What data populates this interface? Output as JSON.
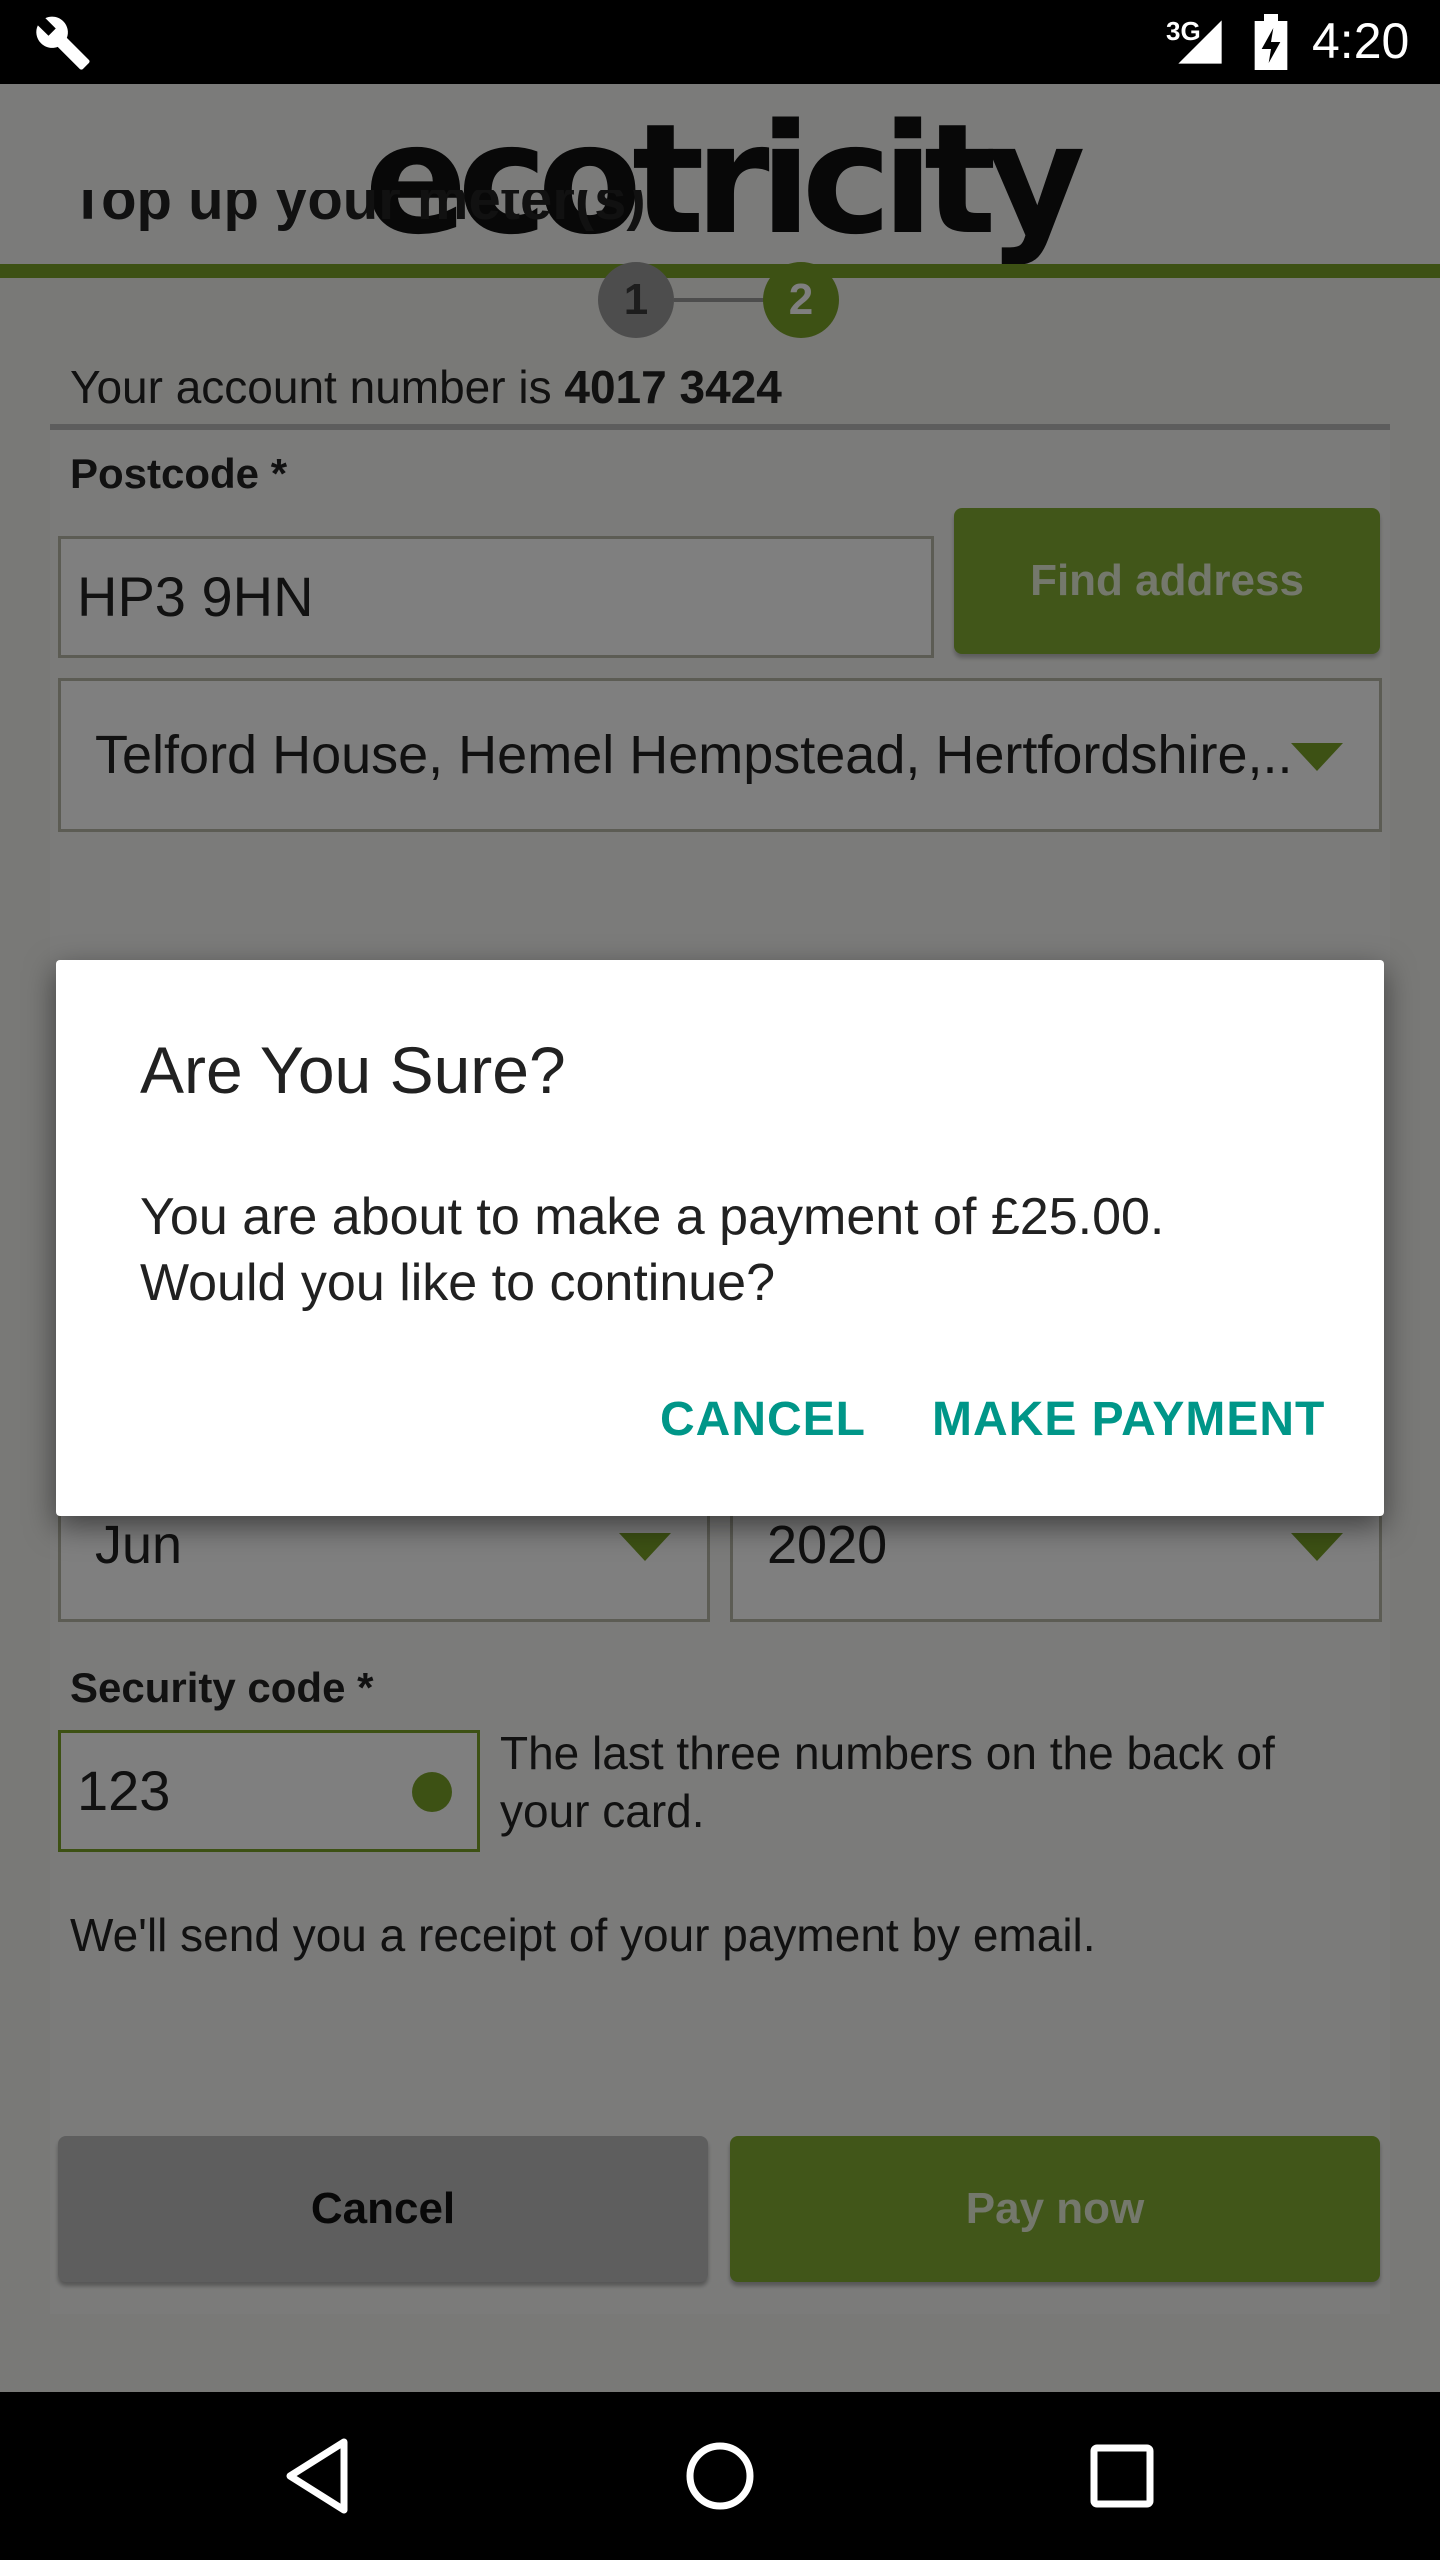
{
  "status_bar": {
    "network_type": "3G",
    "time": "4:20"
  },
  "header": {
    "logo_text": "ecotricity",
    "page_title": "Top up your meter(s)"
  },
  "stepper": {
    "steps": [
      "1",
      "2"
    ],
    "active_step": "2"
  },
  "account": {
    "prefix": "Your account number is",
    "number": "4017 3424"
  },
  "form": {
    "postcode_label": "Postcode *",
    "postcode_value": "HP3 9HN",
    "find_address_label": "Find address",
    "address_value": "Telford House, Hemel Hempstead, Hertfordshire,..",
    "expiry_month": "Jun",
    "expiry_year": "2020",
    "security_label": "Security code *",
    "security_value": "123",
    "security_hint": "The last three numbers on the back of your card.",
    "receipt_note": "We'll send you a receipt of your payment by email.",
    "cancel_label": "Cancel",
    "pay_now_label": "Pay now"
  },
  "dialog": {
    "title": "Are You Sure?",
    "message": "You are about to make a payment of £25.00. Would you like to continue?",
    "cancel_label": "CANCEL",
    "confirm_label": "MAKE PAYMENT"
  },
  "colors": {
    "brand_green": "#7aa329",
    "dialog_accent": "#009688"
  }
}
